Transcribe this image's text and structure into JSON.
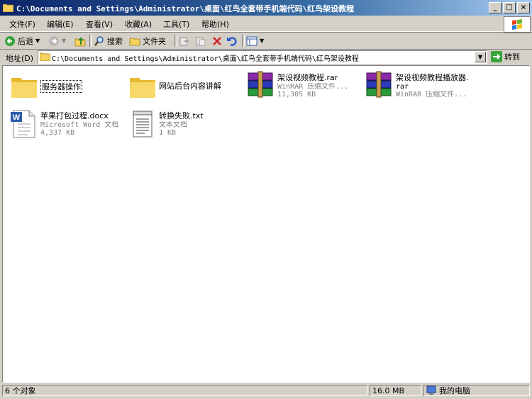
{
  "window": {
    "title": "C:\\Documents and Settings\\Administrator\\桌面\\红鸟全套带手机端代码\\红鸟架设教程",
    "buttons": {
      "minimize": "_",
      "maximize": "□",
      "close": "×"
    }
  },
  "menu": [
    "文件(F)",
    "编辑(E)",
    "查看(V)",
    "收藏(A)",
    "工具(T)",
    "帮助(H)"
  ],
  "toolbar": {
    "back": "后退",
    "search": "搜索",
    "folders": "文件夹"
  },
  "address": {
    "label": "地址(D)",
    "value": "C:\\Documents and Settings\\Administrator\\桌面\\红鸟全套带手机端代码\\红鸟架设教程",
    "go": "转到"
  },
  "files": [
    {
      "name": "服务器操作",
      "type": "",
      "size": "",
      "icon": "folder-icon"
    },
    {
      "name": "网站后台内容讲解",
      "type": "",
      "size": "",
      "icon": "folder-icon"
    },
    {
      "name": "架设视频教程.rar",
      "type": "WinRAR 压缩文件...",
      "size": "11,305 KB",
      "icon": "winrar-icon"
    },
    {
      "name": "架设视频教程播放器.",
      "name2": "rar",
      "type": "WinRAR 压缩文件...",
      "size": "",
      "icon": "winrar-icon"
    },
    {
      "name": "苹果打包过程.docx",
      "type": "Microsoft Word 文档",
      "size": "4,337 KB",
      "icon": "word-doc-icon"
    },
    {
      "name": "转换失败.txt",
      "type": "文本文档",
      "size": "1 KB",
      "icon": "text-doc-icon"
    }
  ],
  "status": {
    "count": "6 个对象",
    "size": "16.0 MB",
    "location": "我的电脑"
  },
  "colors": {
    "titlebar_start": "#0a246a",
    "titlebar_end": "#a6caf0",
    "chrome": "#d4d0c8"
  }
}
